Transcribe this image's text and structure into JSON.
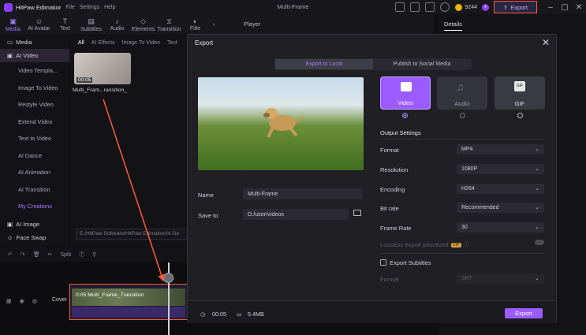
{
  "app": {
    "name": "HitPaw Edimakor",
    "menu": [
      "File",
      "Settings",
      "Help"
    ],
    "document_title": "Multi-Frame",
    "credits": "9244",
    "export_label": "Export",
    "accent_color": "#9b5cff",
    "highlight_color": "#ff5a3c"
  },
  "toolbar": {
    "tools": [
      {
        "label": "Media",
        "icon": "media-icon"
      },
      {
        "label": "AI Avatar",
        "icon": "avatar-icon"
      },
      {
        "label": "Text",
        "icon": "text-icon"
      },
      {
        "label": "Subtitles",
        "icon": "subtitles-icon"
      },
      {
        "label": "Audio",
        "icon": "audio-icon"
      },
      {
        "label": "Elements",
        "icon": "elements-icon"
      },
      {
        "label": "Transition",
        "icon": "transition-icon"
      },
      {
        "label": "Filte",
        "icon": "filter-icon"
      }
    ]
  },
  "player": {
    "label": "Player"
  },
  "details": {
    "tab_label": "Details"
  },
  "sidebar": {
    "media_label": "Media",
    "ai_video_label": "AI Video",
    "items": [
      "Video Templa...",
      "Image To Video",
      "Restyle Video",
      "Extend Video",
      "Text to Video",
      "AI Dance",
      "AI Animation",
      "AI Transition",
      "My Creations"
    ],
    "ai_image_label": "AI Image",
    "face_swap_label": "Face Swap"
  },
  "content": {
    "tabs": [
      "All",
      "AI Effects",
      "Image To Video",
      "Text"
    ],
    "thumb_duration": "00:05",
    "thumb_caption": "Multi_Fram...ransition_",
    "path": "E:/HitPaw Software/HitPaw Edimakor/AI Ge"
  },
  "timeline": {
    "split_label": "Split",
    "cover_label": "Cover",
    "clip_label": "0:05  Multi_Frame_Transition"
  },
  "dialog": {
    "title": "Export",
    "tab_local": "Export to Local",
    "tab_social": "Publish to Social Media",
    "name_label": "Name",
    "name_value": "Multi-Frame",
    "save_label": "Save to",
    "save_value": "D:/user/videos",
    "formats": [
      "Video",
      "Audio",
      "GIF"
    ],
    "output_title": "Output Settings",
    "settings": [
      {
        "label": "Format",
        "value": "MP4"
      },
      {
        "label": "Resolution",
        "value": "1080P"
      },
      {
        "label": "Encoding",
        "value": "H264"
      },
      {
        "label": "Bit rate",
        "value": "Recommended"
      },
      {
        "label": "Frame Rate",
        "value": "30"
      }
    ],
    "lossless_label": "Lossless export prioritized",
    "vip_badge": "VIP",
    "subtitles_label": "Export Subtitles",
    "sub_format_label": "Format",
    "sub_format_value": "SRT",
    "duration": "00:05",
    "size": "5.4MB",
    "export_button": "Export"
  }
}
